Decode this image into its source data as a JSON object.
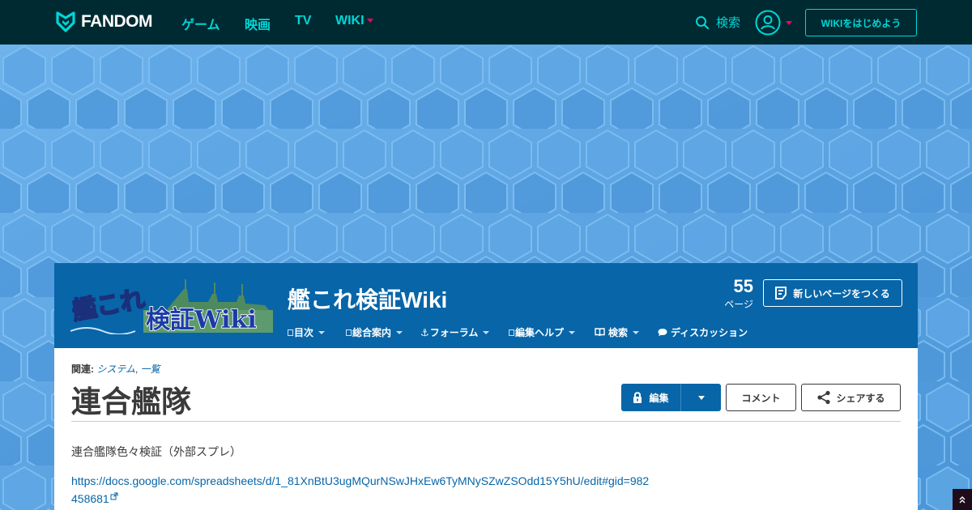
{
  "topnav": {
    "brand": "FANDOM",
    "links": [
      "ゲーム",
      "映画",
      "TV"
    ],
    "wiki_label": "WIKI",
    "search_label": "検索",
    "start_wiki_label": "WIKIをはじめよう",
    "accent": "#00d6d6",
    "background": "#002a32"
  },
  "wiki": {
    "logo_text_1": "艦これ",
    "logo_text_2": "検証Wiki",
    "title": "艦これ検証Wiki",
    "page_count": "55",
    "page_count_label": "ページ",
    "new_page_label": "新しいページをつくる",
    "nav": [
      "目次",
      "総合案内",
      "フォーラム",
      "編集ヘルプ",
      "検索",
      "ディスカッション"
    ],
    "header_color": "#0765a8"
  },
  "page": {
    "related_label": "関連:",
    "related_links": [
      "システム",
      "一覧"
    ],
    "title": "連合艦隊",
    "edit_label": "編集",
    "comment_label": "コメント",
    "share_label": "シェアする",
    "description": "連合艦隊色々検証（外部スプレ）",
    "link_url": "https://docs.google.com/spreadsheets/d/1_81XnBtU3ugMQurNSwJHxEw6TyMNySZwZSOdd15Y5hU/edit#gid=982458681"
  }
}
